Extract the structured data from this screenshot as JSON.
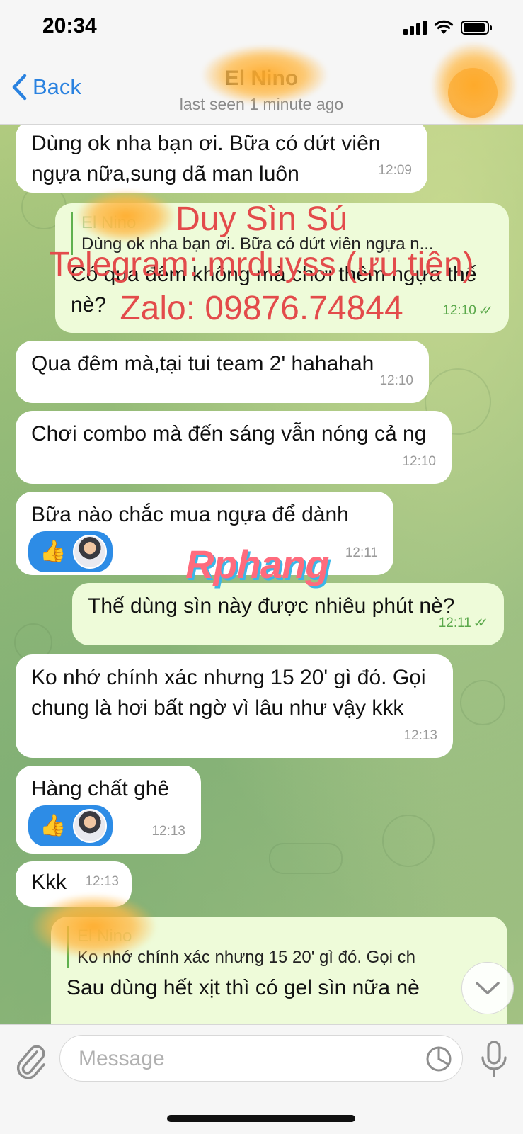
{
  "status_bar": {
    "time": "20:34",
    "icons": [
      "signal-icon",
      "wifi-icon",
      "battery-icon"
    ]
  },
  "header": {
    "back_label": "Back",
    "title": "El Nino",
    "subtitle": "last seen 1 minute ago"
  },
  "messages": [
    {
      "dir": "in",
      "text": "Dùng ok nha bạn ơi. Bữa có dứt viên ngựa nữa,sung dã man luôn",
      "time": "12:09"
    },
    {
      "dir": "out",
      "reply_name": "El Nino",
      "reply_text": "Dùng ok nha bạn ơi. Bữa có dứt viên ngựa n...",
      "text": "Có qua đêm không mà chơi thêm ngựa thế nè?",
      "time": "12:10",
      "read": true
    },
    {
      "dir": "in",
      "text": "Qua đêm mà,tại tui team 2' hahahah",
      "time": "12:10"
    },
    {
      "dir": "in",
      "text": "Chơi combo mà đến sáng vẫn nóng cả ng",
      "time": "12:10"
    },
    {
      "dir": "in",
      "text": "Bữa nào chắc mua ngựa để dành",
      "time": "12:11",
      "reaction": "👍"
    },
    {
      "dir": "out",
      "text": "Thế dùng sìn này được nhiêu phút nè?",
      "time": "12:11",
      "read": true
    },
    {
      "dir": "in",
      "text": "Ko nhớ chính xác nhưng 15 20' gì đó. Gọi chung là hơi bất ngờ vì lâu như vậy kkk",
      "time": "12:13"
    },
    {
      "dir": "in",
      "text": "Hàng chất ghê",
      "time": "12:13",
      "reaction": "👍"
    },
    {
      "dir": "in",
      "text": "Kkk",
      "time": "12:13"
    },
    {
      "dir": "out",
      "reply_name": "El Nino",
      "reply_text": "Ko nhớ chính xác nhưng 15 20' gì đó. Gọi ch",
      "text": "Sau dùng hết xịt thì có gel sìn nữa nè",
      "time": ""
    }
  ],
  "watermark": {
    "line1": "Duy Sìn Sú",
    "line2": "Telegram: mrduyss (ưu tiên)",
    "line3": "Zalo: 09876.74844",
    "logo": "Rphang"
  },
  "input": {
    "placeholder": "Message",
    "value": ""
  },
  "colors": {
    "accent": "#2a82e0",
    "outgoing_bubble": "#eefbd9",
    "incoming_bubble": "#ffffff",
    "watermark": "#e34b4b",
    "read_check": "#5aa84a"
  }
}
